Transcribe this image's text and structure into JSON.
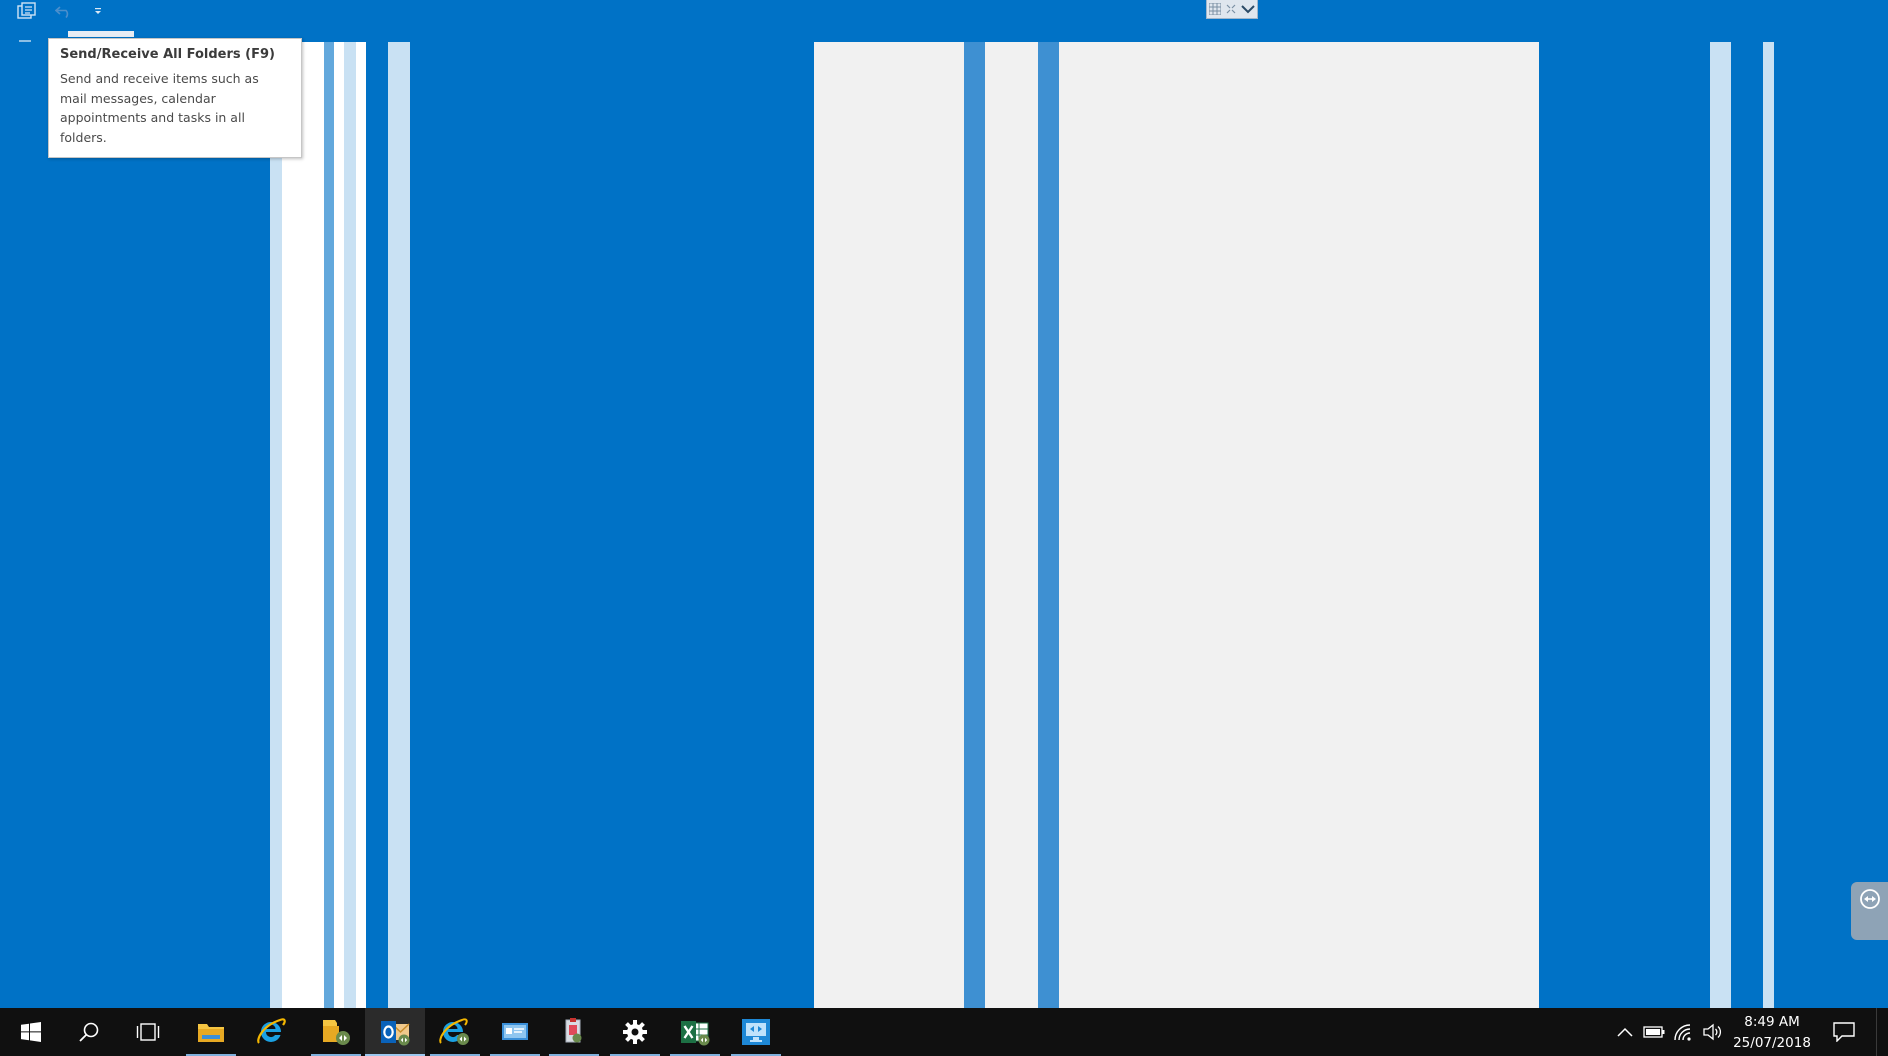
{
  "tooltip": {
    "title": "Send/Receive All Folders (F9)",
    "description": "Send and receive items such as mail messages, calendar appointments and tasks in all folders."
  },
  "taskbar": {
    "apps": [
      {
        "icon": "windows-start-icon"
      },
      {
        "icon": "search-icon"
      },
      {
        "icon": "task-view-icon"
      },
      {
        "icon": "file-explorer-icon"
      },
      {
        "icon": "internet-explorer-icon"
      },
      {
        "icon": "file-explorer-remote-icon"
      },
      {
        "icon": "outlook-icon"
      },
      {
        "icon": "internet-explorer-remote-icon"
      },
      {
        "icon": "control-panel-icon"
      },
      {
        "icon": "remote-app-icon"
      },
      {
        "icon": "settings-gear-icon"
      },
      {
        "icon": "excel-remote-icon"
      },
      {
        "icon": "remote-desktop-icon"
      }
    ],
    "tray": {
      "time": "8:49 AM",
      "date": "25/07/2018"
    }
  },
  "colors": {
    "desktop_blue": "#0072c6",
    "taskbar": "#101010",
    "tooltip_bg": "#ffffff"
  }
}
